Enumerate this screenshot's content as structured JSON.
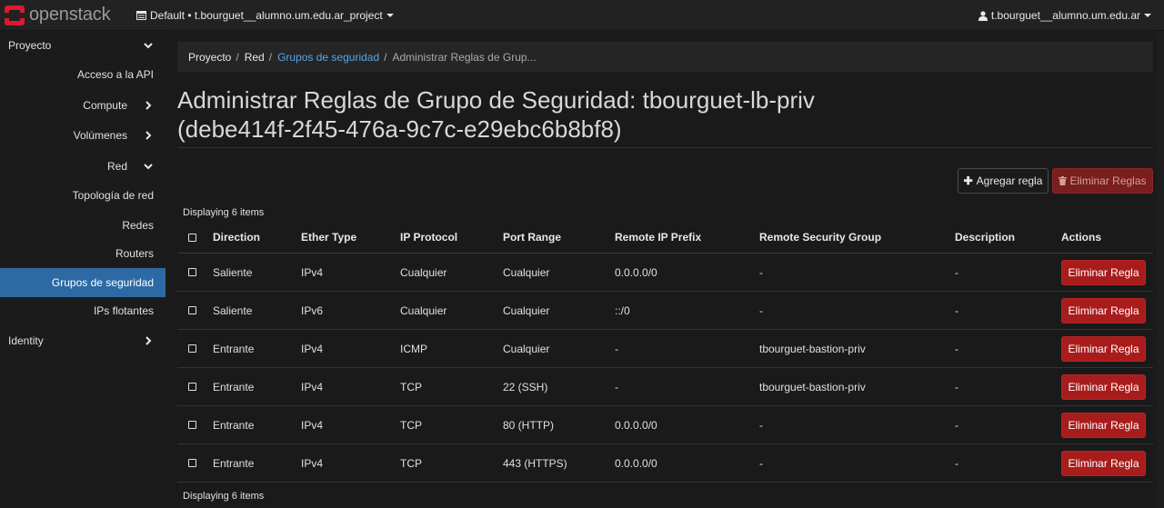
{
  "brand": {
    "name": "openstack",
    "logo_color": "#da1a32"
  },
  "topbar": {
    "project_label": "Default • t.bourguet__alumno.um.edu.ar_project",
    "user_label": "t.bourguet__alumno.um.edu.ar"
  },
  "sidebar": {
    "active_color": "#2d6aa5",
    "items": [
      {
        "label": "Proyecto",
        "level": 0,
        "chevron": "down"
      },
      {
        "label": "Acceso a la API",
        "level": 2
      },
      {
        "label": "Compute",
        "level": 1,
        "chevron": "right"
      },
      {
        "label": "Volúmenes",
        "level": 1,
        "chevron": "right"
      },
      {
        "label": "Red",
        "level": 1,
        "chevron": "down"
      },
      {
        "label": "Topología de red",
        "level": 2
      },
      {
        "label": "Redes",
        "level": 2
      },
      {
        "label": "Routers",
        "level": 2
      },
      {
        "label": "Grupos de seguridad",
        "level": 2,
        "active": true
      },
      {
        "label": "IPs flotantes",
        "level": 2
      },
      {
        "label": "Identity",
        "level": 0,
        "chevron": "right"
      }
    ]
  },
  "breadcrumb": [
    "Proyecto",
    "Red",
    "Grupos de seguridad",
    "Administrar Reglas de Grup..."
  ],
  "page": {
    "title_line1": "Administrar Reglas de Grupo de Seguridad: tbourguet-lb-priv",
    "title_line2": "(debe414f-2f45-476a-9c7c-e29ebc6b8bf8)"
  },
  "actions": {
    "add_rule": "Agregar regla",
    "delete_rules": "Eliminar Reglas"
  },
  "table": {
    "displaying": "Displaying 6 items",
    "columns": [
      "Direction",
      "Ether Type",
      "IP Protocol",
      "Port Range",
      "Remote IP Prefix",
      "Remote Security Group",
      "Description",
      "Actions"
    ],
    "delete_label": "Eliminar Regla",
    "rows": [
      [
        "Saliente",
        "IPv4",
        "Cualquier",
        "Cualquier",
        "0.0.0.0/0",
        "-",
        "-"
      ],
      [
        "Saliente",
        "IPv6",
        "Cualquier",
        "Cualquier",
        "::/0",
        "-",
        "-"
      ],
      [
        "Entrante",
        "IPv4",
        "ICMP",
        "Cualquier",
        "-",
        "tbourguet-bastion-priv",
        "-"
      ],
      [
        "Entrante",
        "IPv4",
        "TCP",
        "22 (SSH)",
        "-",
        "tbourguet-bastion-priv",
        "-"
      ],
      [
        "Entrante",
        "IPv4",
        "TCP",
        "80 (HTTP)",
        "0.0.0.0/0",
        "-",
        "-"
      ],
      [
        "Entrante",
        "IPv4",
        "TCP",
        "443 (HTTPS)",
        "0.0.0.0/0",
        "-",
        "-"
      ]
    ]
  }
}
